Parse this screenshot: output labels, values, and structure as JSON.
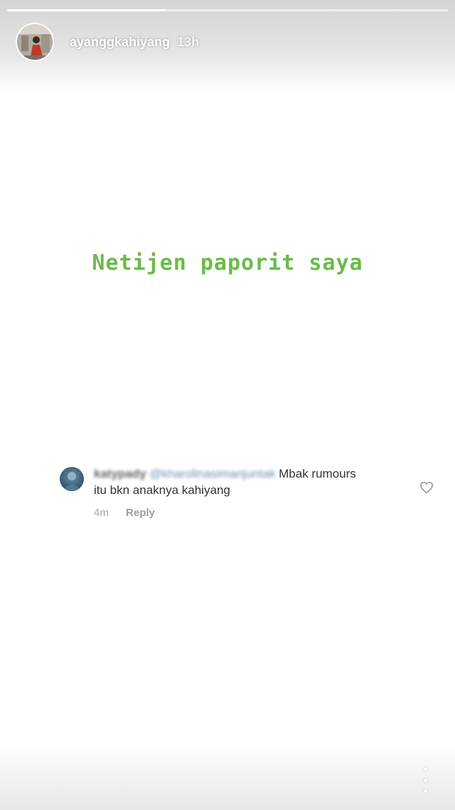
{
  "story": {
    "progress": 0.36,
    "username": "ayanggkahiyang",
    "time": "13h",
    "text": "Netijen paporit saya",
    "text_color": "#6abb4a"
  },
  "comment": {
    "handle": "katypady",
    "mention": "@kharolinasimanjuntak",
    "message_line1": "Mbak rumours",
    "message_line2": "itu bkn anaknya kahiyang",
    "age": "4m",
    "reply_label": "Reply"
  },
  "icons": {
    "like": "heart-outline-icon",
    "more": "vertical-dots-icon"
  }
}
